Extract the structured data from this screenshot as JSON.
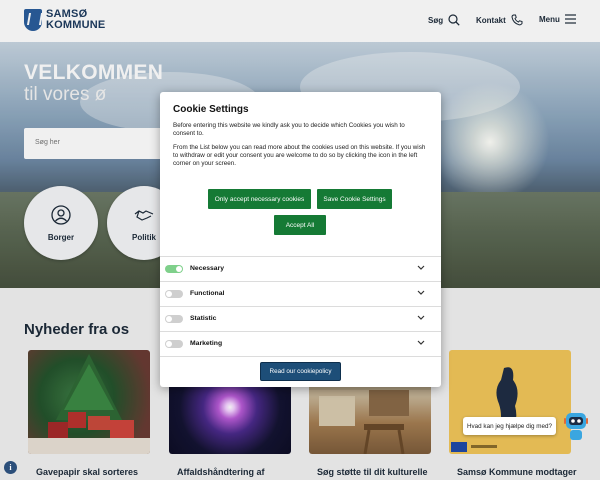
{
  "header": {
    "logo_line1": "SAMSØ",
    "logo_line2": "KOMMUNE",
    "nav_search": "Søg",
    "nav_contact": "Kontakt",
    "nav_menu": "Menu"
  },
  "hero": {
    "title_line1": "VELKOMMEN",
    "title_line2": "til vores ø",
    "search_placeholder": "Søg her",
    "circles": [
      {
        "label": "Borger",
        "icon": "person-icon"
      },
      {
        "label": "Politik",
        "icon": "handshake-icon"
      }
    ]
  },
  "news": {
    "heading": "Nyheder fra os",
    "cards": [
      {
        "title": "Gavepapir skal sorteres"
      },
      {
        "title": "Affaldshåndtering af"
      },
      {
        "title": "Søg støtte til dit kulturelle"
      },
      {
        "title": "Samsø Kommune modtager"
      }
    ]
  },
  "cookie_modal": {
    "title": "Cookie Settings",
    "paragraph1": "Before entering this website we kindly ask you to decide which Cookies you wish to consent to.",
    "paragraph2": "From the List below you can read more about the cookies used on this website. If you wish to withdraw or edit your consent you are welcome to do so by clicking the icon in the left corner on your screen.",
    "btn_necessary": "Only accept necessary cookies",
    "btn_save": "Save Cookie Settings",
    "btn_accept_all": "Accept All",
    "categories": [
      {
        "name": "Necessary",
        "enabled": true
      },
      {
        "name": "Functional",
        "enabled": false
      },
      {
        "name": "Statistic",
        "enabled": false
      },
      {
        "name": "Marketing",
        "enabled": false
      }
    ],
    "policy_button": "Read our cookiepolicy"
  },
  "chat": {
    "bubble_text": "Hvad kan jeg hjælpe dig med?"
  },
  "colors": {
    "primary_green": "#157a35",
    "policy_blue": "#1d4e78",
    "toggle_on": "#7fd08b"
  }
}
